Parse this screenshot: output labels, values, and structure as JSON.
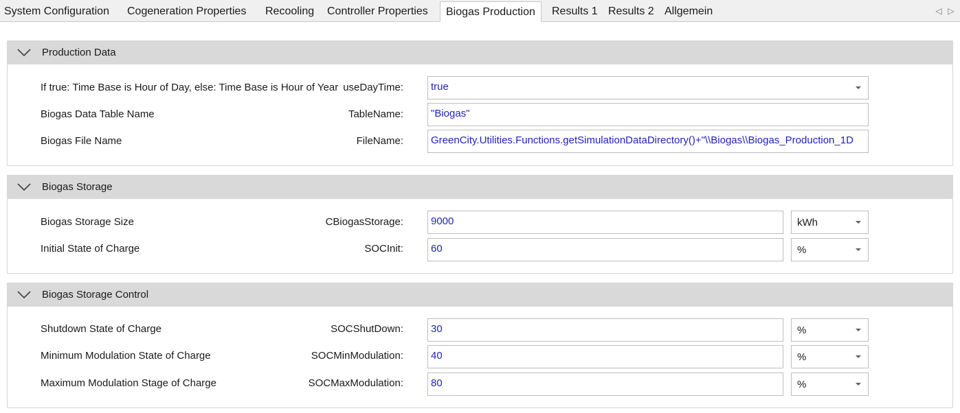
{
  "tabs": [
    {
      "label": "System Configuration"
    },
    {
      "label": "Cogeneration Properties"
    },
    {
      "label": "Recooling"
    },
    {
      "label": "Controller Properties"
    },
    {
      "label": "Biogas Production",
      "active": true
    },
    {
      "label": "Results 1"
    },
    {
      "label": "Results 2"
    },
    {
      "label": "Allgemein"
    }
  ],
  "sections": [
    {
      "title": "Production Data",
      "rows": [
        {
          "label": "If true: Time Base is Hour of Day, else: Time Base is Hour of Year",
          "param": "useDayTime:",
          "value": "true"
        },
        {
          "label": "Biogas Data Table Name",
          "param": "TableName:",
          "value": "\"Biogas\""
        },
        {
          "label": "Biogas File Name",
          "param": "FileName:",
          "value": "GreenCity.Utilities.Functions.getSimulationDataDirectory()+\"\\\\Biogas\\\\Biogas_Production_1D"
        }
      ]
    },
    {
      "title": "Biogas Storage",
      "rows": [
        {
          "label": "Biogas Storage Size",
          "param": "CBiogasStorage:",
          "value": "9000",
          "unit": "kWh"
        },
        {
          "label": "Initial State of Charge",
          "param": "SOCInit:",
          "value": "60",
          "unit": "%"
        }
      ]
    },
    {
      "title": "Biogas Storage Control",
      "rows": [
        {
          "label": "Shutdown State of Charge",
          "param": "SOCShutDown:",
          "value": "30",
          "unit": "%"
        },
        {
          "label": "Minimum Modulation State of Charge",
          "param": "SOCMinModulation:",
          "value": "40",
          "unit": "%"
        },
        {
          "label": "Maximum Modulation Stage of Charge",
          "param": "SOCMaxModulation:",
          "value": "80",
          "unit": "%"
        }
      ]
    }
  ],
  "colors": {
    "value_text": "#1f1fbf",
    "section_header": "#d9d9d9",
    "tabbar": "#f0f0f0"
  },
  "icons": {
    "collapse": "chevron-down-icon",
    "dropdown": "caret-down-icon",
    "tab_scroll_left": "triangle-left-icon",
    "tab_scroll_right": "triangle-right-icon"
  }
}
